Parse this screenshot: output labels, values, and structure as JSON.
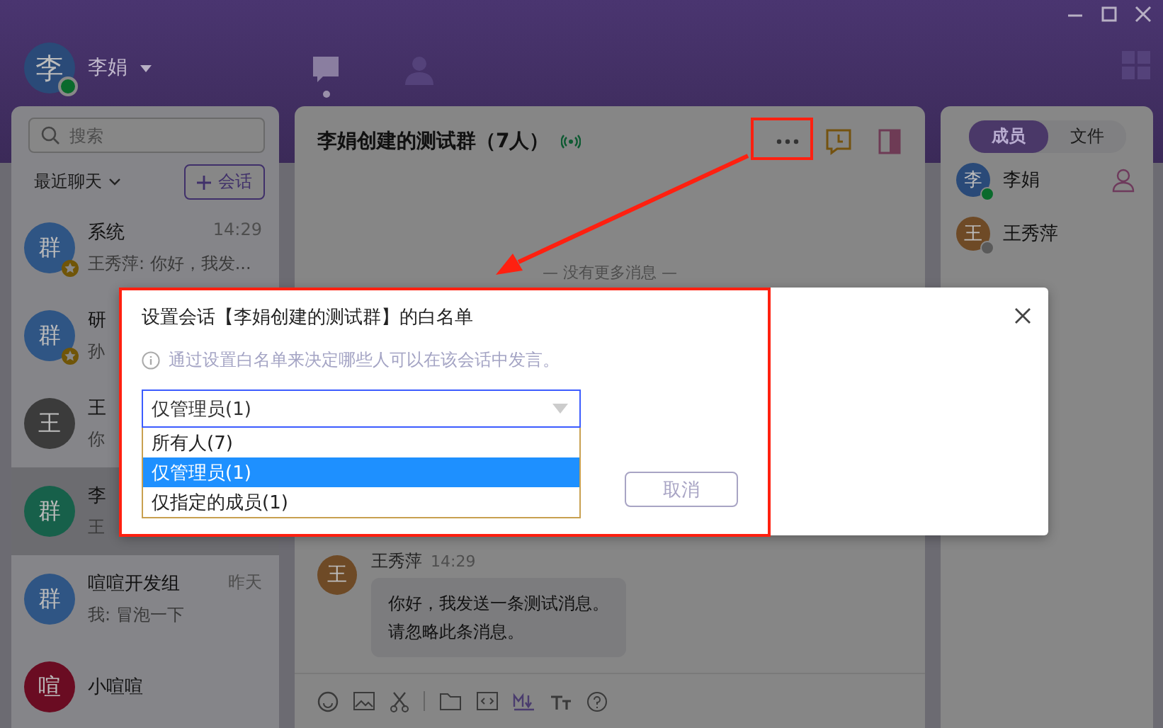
{
  "user": {
    "avatar": "李",
    "name": "李娟",
    "online": true
  },
  "search": {
    "placeholder": "搜索"
  },
  "list_filter": "最近聊天",
  "new_chat_button": "会话",
  "chats": [
    {
      "avatar": "群",
      "color": "#2f5584",
      "name": "系统",
      "time": "14:29",
      "preview": "王秀萍: 你好，我发...",
      "starred": true,
      "selected": false
    },
    {
      "avatar": "群",
      "color": "#2f5584",
      "name": "研",
      "preview": "孙",
      "starred": true,
      "selected": false
    },
    {
      "avatar": "王",
      "color": "#3b3b3b",
      "name": "王",
      "preview": "你",
      "starred": false,
      "selected": false
    },
    {
      "avatar": "群",
      "color": "#17604a",
      "name": "李",
      "preview": "王",
      "starred": false,
      "selected": true
    },
    {
      "avatar": "群",
      "color": "#2f5584",
      "name": "喧喧开发组",
      "time": "昨天",
      "preview": "我: 冒泡一下",
      "starred": false,
      "selected": false
    },
    {
      "avatar": "喧",
      "color": "#6a0c22",
      "name": "小喧喧",
      "starred": false,
      "selected": false
    }
  ],
  "chat": {
    "title": "李娟创建的测试群（7人）",
    "no_more": "— 没有更多消息 —",
    "messages": [
      {
        "avatar": "王",
        "color": "#6e4a26",
        "sender": "王秀萍",
        "time": "14:29",
        "lines": [
          "你好，我发送一条测试消息。",
          "请忽略此条消息。"
        ]
      }
    ]
  },
  "side_tabs": [
    {
      "label": "成员",
      "selected": true
    },
    {
      "label": "文件",
      "selected": false
    }
  ],
  "members": [
    {
      "avatar": "李",
      "color": "#2a4a78",
      "name": "李娟",
      "online": true
    },
    {
      "avatar": "王",
      "color": "#6e4a26",
      "name": "王秀萍",
      "online": false
    }
  ],
  "dialog": {
    "title": "设置会话【李娟创建的测试群】的白名单",
    "hint": "通过设置白名单来决定哪些人可以在该会话中发言。",
    "select_value": "仅管理员(1)",
    "options": [
      {
        "label": "所有人(7)",
        "selected": false
      },
      {
        "label": "仅管理员(1)",
        "selected": true
      },
      {
        "label": "仅指定的成员(1)",
        "selected": false
      }
    ],
    "cancel_button": "取消"
  }
}
